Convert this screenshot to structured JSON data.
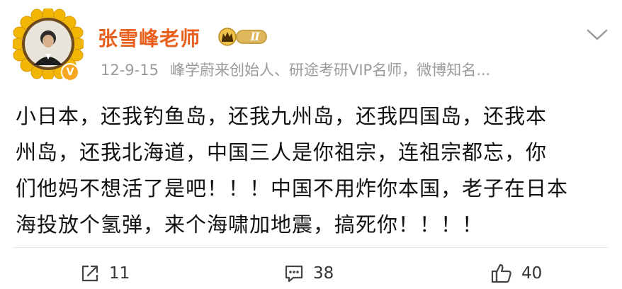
{
  "post": {
    "username": "张雪峰老师",
    "vip_level": "Ⅱ",
    "verified_mark": "V",
    "date": "12-9-15",
    "bio": "峰学蔚来创始人、研途考研VIP名师，微博知名...",
    "content_lines": [
      "小日本，还我钓鱼岛，还我九州岛，还我四国岛，还我本",
      "州岛，还我北海道，中国三人是你祖宗，连祖宗都忘，你",
      "们他妈不想活了是吧！！！中国不用炸你本国，老子在日本",
      "海投放个氢弹，来个海啸加地震，搞死你！！！！"
    ]
  },
  "actions": {
    "repost_count": "11",
    "comment_count": "38",
    "like_count": "40"
  },
  "colors": {
    "username": "#e8601c",
    "meta": "#9a9a9a",
    "verified": "#f6a623",
    "sunflower_petal": "#f2b705"
  },
  "icons": [
    "sunflower-avatar",
    "crown-vip-badge-icon",
    "chevron-down-icon",
    "repost-icon",
    "comment-icon",
    "like-icon"
  ]
}
